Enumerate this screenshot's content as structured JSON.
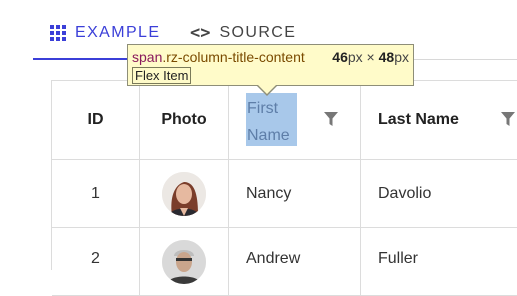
{
  "tabs": {
    "example_label": "EXAMPLE",
    "source_label": "SOURCE",
    "example_icon": "grid-icon",
    "source_icon": "code-icon",
    "accent_color": "#3b3fd8"
  },
  "tooltip": {
    "tag": "span",
    "class_name": ".rz-column-title-content",
    "width_value": "46",
    "width_unit": "px",
    "times": "×",
    "height_value": "48",
    "height_unit": "px",
    "badge": "Flex Item",
    "background_color": "#fffbc9"
  },
  "table": {
    "headers": {
      "id": "ID",
      "photo": "Photo",
      "first_name": "First Name",
      "last_name": "Last Name"
    },
    "highlight_color": "#a8c8ea",
    "rows": [
      {
        "id": "1",
        "photo": "avatar-nancy",
        "first_name": "Nancy",
        "last_name": "Davolio"
      },
      {
        "id": "2",
        "photo": "avatar-andrew",
        "first_name": "Andrew",
        "last_name": "Fuller"
      }
    ]
  }
}
